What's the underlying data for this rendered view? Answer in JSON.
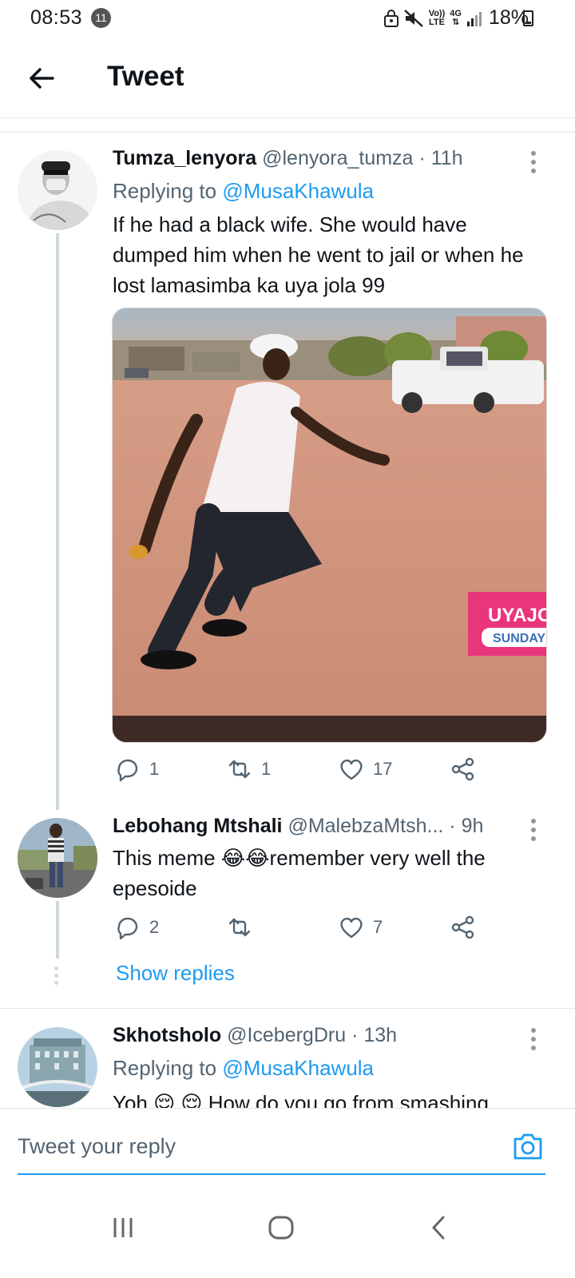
{
  "status_bar": {
    "time": "08:53",
    "notification_count": "11",
    "network_volte": "Vo))",
    "network_lte": "LTE",
    "network_4g": "4G",
    "battery": "18%"
  },
  "header": {
    "title": "Tweet"
  },
  "tweets": [
    {
      "display_name": "Tumza_lenyora",
      "handle": "@lenyora_tumza",
      "time": "· 11h",
      "replying_prefix": "Replying to",
      "replying_to": "@MusaKhawula",
      "text": "If he had a black wife. She would have dumped him when he went to jail or when he lost lamasimba ka uya jola 99",
      "media_overlay_line1": "UYAJOL",
      "media_overlay_line2": "SUNDAY",
      "replies": "1",
      "retweets": "1",
      "likes": "17"
    },
    {
      "display_name": "Lebohang Mtshali",
      "handle": "@MalebzaMtsh...",
      "time": "· 9h",
      "text": "This meme 😂😂remember very well the epesoide",
      "replies": "2",
      "retweets": "",
      "likes": "7",
      "show_replies": "Show replies"
    },
    {
      "display_name": "Skhotsholo",
      "handle": "@IcebergDru",
      "time": "· 13h",
      "replying_prefix": "Replying to",
      "replying_to": "@MusaKhawula",
      "text": "Yoh 😌 😌 How do you go from smashing"
    }
  ],
  "reply_bar": {
    "placeholder": "Tweet your reply"
  },
  "icons": {
    "back": "arrow-left-icon",
    "more": "more-vertical-icon",
    "reply": "reply-bubble-icon",
    "retweet": "retweet-icon",
    "like": "heart-icon",
    "share": "share-icon",
    "camera": "camera-icon",
    "nav_recent": "recent-apps-icon",
    "nav_home": "home-icon",
    "nav_back": "nav-back-icon"
  },
  "colors": {
    "accent": "#1d9bf0",
    "text": "#0f1419",
    "secondary": "#536471",
    "thread_line": "#cfd9de"
  }
}
